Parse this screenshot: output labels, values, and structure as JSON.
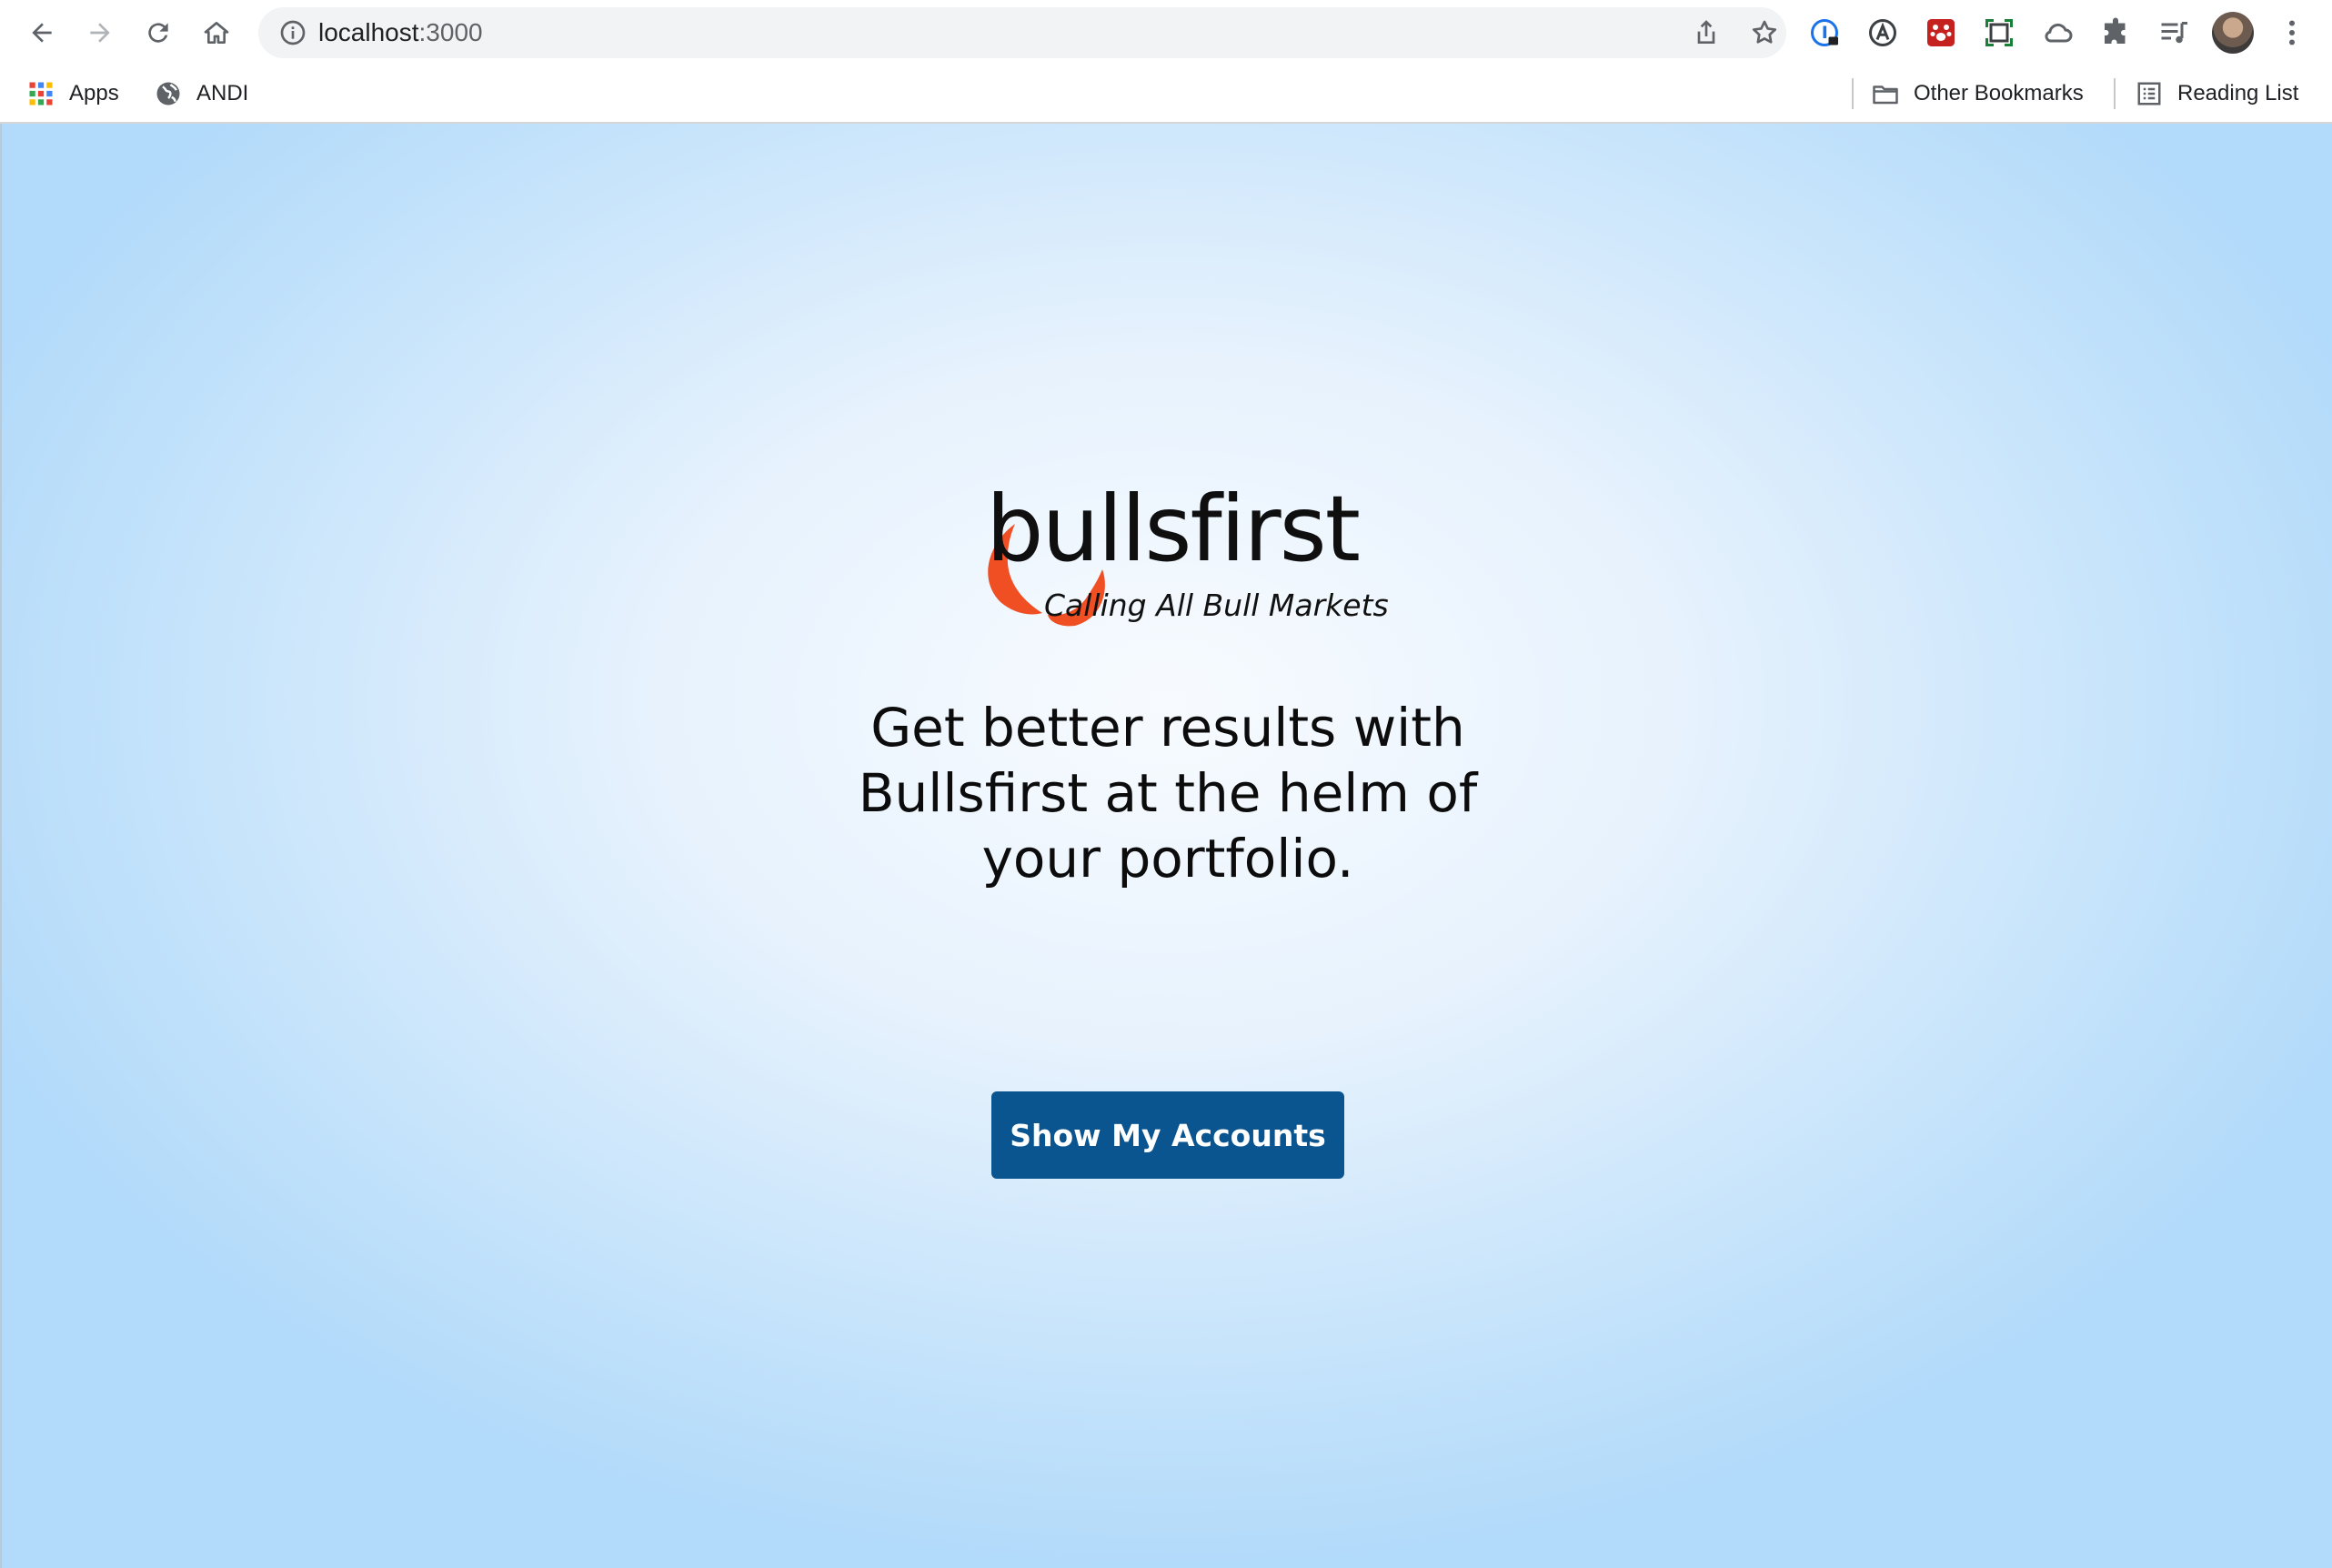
{
  "browser": {
    "url_host": "localhost",
    "url_port": ":3000",
    "bookmarks": {
      "apps_label": "Apps",
      "andi_label": "ANDI",
      "other_bookmarks_label": "Other Bookmarks",
      "reading_list_label": "Reading List"
    },
    "icons": {
      "back": "arrow-left-icon",
      "forward": "arrow-right-icon",
      "reload": "reload-icon",
      "home": "home-icon",
      "site_info": "info-icon",
      "share": "share-icon",
      "bookmark": "star-icon",
      "extensions": [
        "password-manager-icon",
        "accessibility-a-icon",
        "paw-icon",
        "screenshot-icon",
        "cloud-icon",
        "puzzle-icon",
        "media-queue-icon"
      ],
      "menu": "kebab-menu-icon"
    }
  },
  "page": {
    "brand_name": "bullsfirst",
    "tagline": "Calling All Bull Markets",
    "hero_text": "Get better results with Bullsfirst at the helm of your portfolio.",
    "cta_label": "Show My Accounts"
  },
  "colors": {
    "accent": "#0a5590",
    "logo_horns": "#f04e23",
    "background_center": "#f7fbff",
    "background_edge": "#b2dafa"
  }
}
